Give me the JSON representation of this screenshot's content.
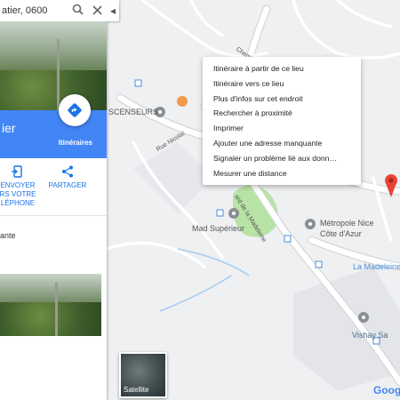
{
  "search": {
    "query": "atier, 0600"
  },
  "place": {
    "name_fragment": "ier",
    "directions_label": "Itinéraires"
  },
  "actions": [
    {
      "label_lines": [
        "ENVOYER",
        "RS VOTRE",
        "LÉPHONE"
      ]
    },
    {
      "label_lines": [
        "PARTAGER"
      ]
    }
  ],
  "panel": {
    "add_text": "ante"
  },
  "map": {
    "labels": {
      "chemin": "Chemin",
      "rue_nicolai": "Rue Nicolaï",
      "boulevard": "ard de la Madeleine",
      "escalators": "SCENSEURS",
      "mad_superieur": "Mad Supérieur",
      "metropole": "Métropole Nice",
      "metropole_line2": "Côte d'Azur",
      "madeleine": "La Madeleine",
      "vishay": "Vishay Sa"
    },
    "satellite_label": "Satellite",
    "google_logo": "Goog"
  },
  "context_menu": {
    "items": [
      "Itinéraire à partir de ce lieu",
      "Itinéraire vers ce lieu",
      "Plus d'infos sur cet endroit",
      "Rechercher à proximité",
      "Imprimer",
      "Ajouter une adresse manquante",
      "Signaler un problème lié aux donn…",
      "Mesurer une distance"
    ]
  },
  "colors": {
    "accent": "#4285f4",
    "pin": "#ea4335",
    "park": "#b7e3a6",
    "water": "#a3ccf2"
  }
}
